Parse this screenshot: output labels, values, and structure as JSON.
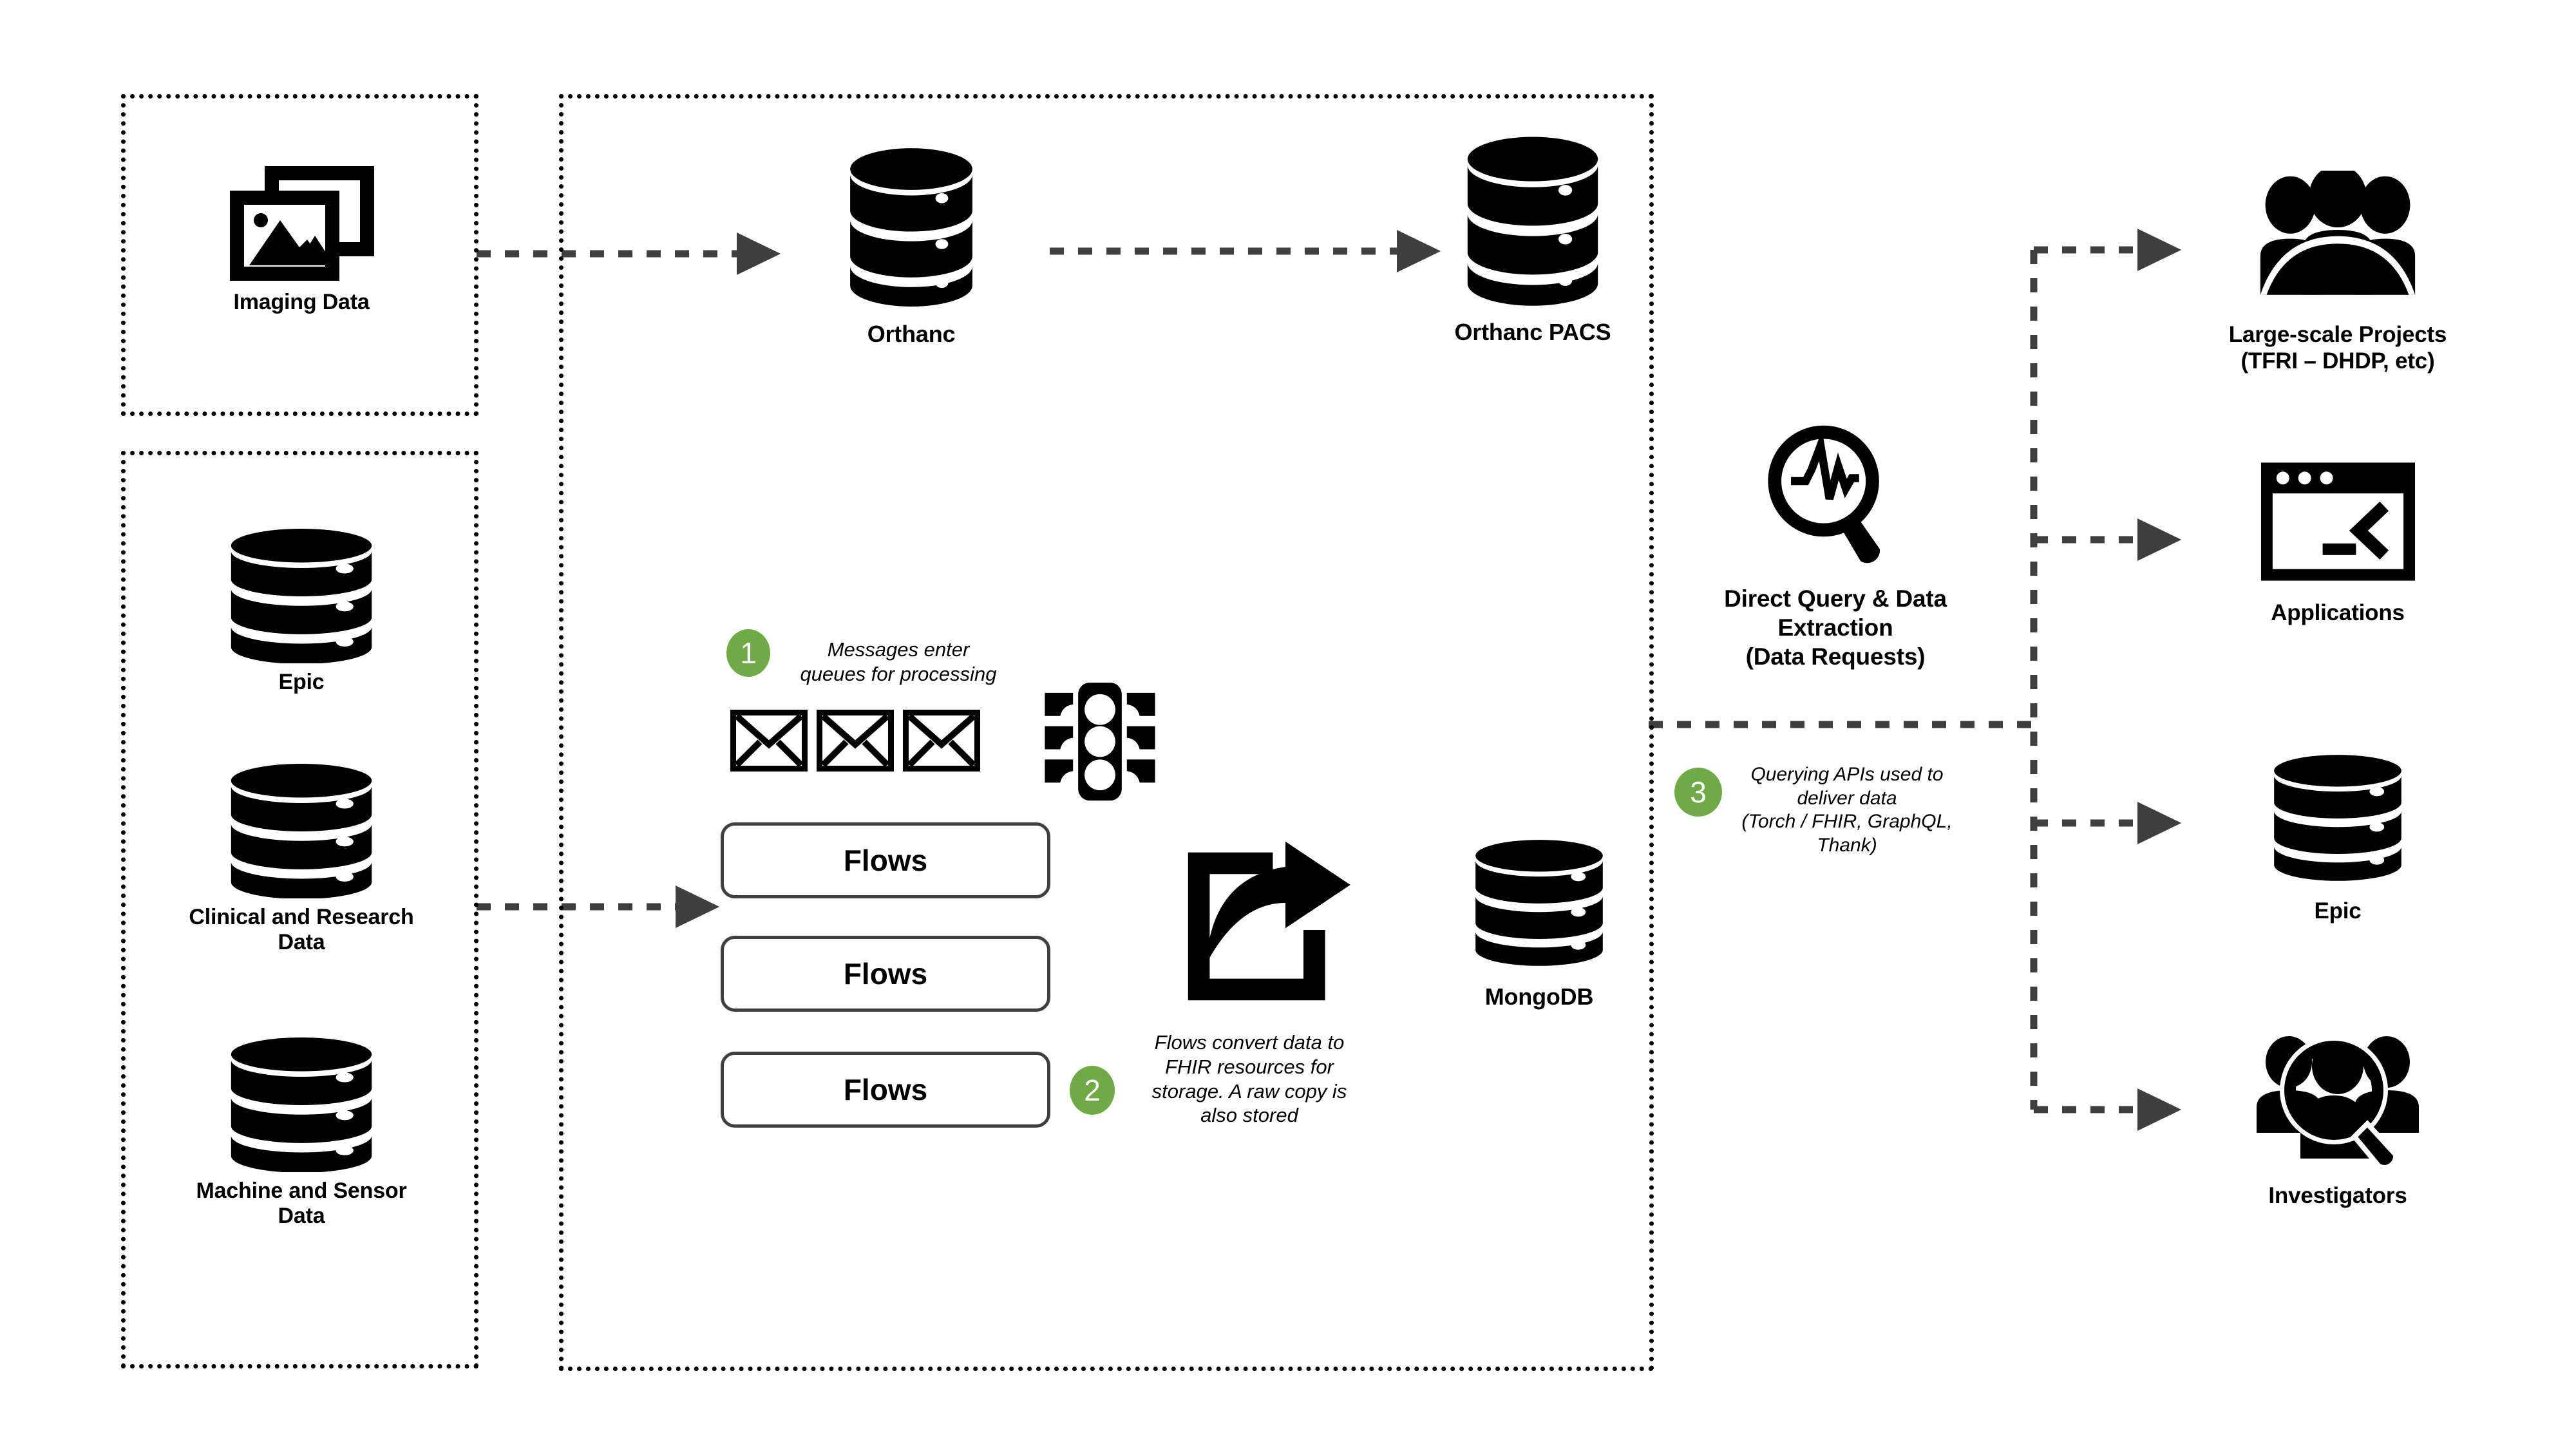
{
  "theme": {
    "accent_green": "#6FAA47",
    "ink": "#000000",
    "arrow_gray": "#3F3F3F",
    "flow_border": "#3F3F3F",
    "background": "#FFFFFF"
  },
  "sources": {
    "imaging_group": {
      "items": [
        {
          "label": "Imaging Data",
          "icon": "images-stack-icon"
        }
      ]
    },
    "data_group": {
      "items": [
        {
          "label": "Epic",
          "icon": "database-icon"
        },
        {
          "label": "Clinical and Research\nData",
          "line1": "Clinical and Research",
          "line2": "Data",
          "icon": "database-icon"
        },
        {
          "label": "Machine and Sensor\nData",
          "line1": "Machine and Sensor",
          "line2": "Data",
          "icon": "database-icon"
        }
      ]
    }
  },
  "platform": {
    "imaging_pipeline": [
      {
        "label": "Orthanc",
        "icon": "database-icon"
      },
      {
        "label": "Orthanc PACS",
        "icon": "database-icon"
      }
    ],
    "queue": {
      "message_icons": [
        "envelope-icon",
        "envelope-icon",
        "envelope-icon"
      ],
      "signal_icon": "traffic-light-icon"
    },
    "flows": [
      {
        "label": "Flows"
      },
      {
        "label": "Flows"
      },
      {
        "label": "Flows"
      }
    ],
    "convert_icon": "share-export-icon",
    "storage": {
      "label": "MongoDB",
      "icon": "database-icon"
    }
  },
  "steps": [
    {
      "number": "1",
      "text": "Messages enter\nqueues for processing",
      "lines": [
        "Messages enter",
        "queues for processing"
      ]
    },
    {
      "number": "2",
      "text": "Flows convert data to FHIR resources for storage. A raw copy is also stored",
      "lines": [
        "Flows convert data to",
        "FHIR resources for",
        "storage. A raw copy is",
        "also stored"
      ]
    },
    {
      "number": "3",
      "text": "Querying APIs used to deliver data (Torch / FHIR, GraphQL, Thank)",
      "lines": [
        "Querying APIs used to",
        "deliver data",
        "(Torch / FHIR, GraphQL,",
        "Thank)"
      ]
    }
  ],
  "query_hub": {
    "icon": "magnifier-pulse-icon",
    "lines": [
      "Direct Query & Data",
      "Extraction",
      "(Data Requests)"
    ]
  },
  "consumers": [
    {
      "icon": "people-group-icon",
      "lines": [
        "Large-scale Projects",
        "(TFRI – DHDP, etc)"
      ]
    },
    {
      "icon": "terminal-window-icon",
      "lines": [
        "Applications"
      ]
    },
    {
      "icon": "database-icon",
      "lines": [
        "Epic"
      ]
    },
    {
      "icon": "user-search-icon",
      "lines": [
        "Investigators"
      ]
    }
  ]
}
